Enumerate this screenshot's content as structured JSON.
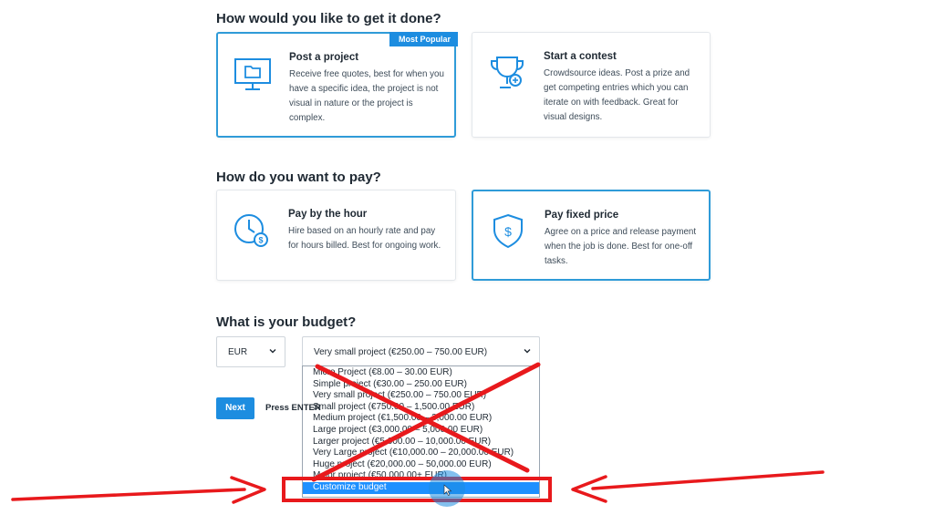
{
  "section1": {
    "heading": "How would you like to get it done?",
    "cards": [
      {
        "title": "Post a project",
        "desc": "Receive free quotes, best for when you have a specific idea, the project is not visual in nature or the project is complex.",
        "badge": "Most Popular",
        "icon": "monitor-folder-icon",
        "selected": true
      },
      {
        "title": "Start a contest",
        "desc": "Crowdsource ideas. Post a prize and get competing entries which you can iterate on with feedback. Great for visual designs.",
        "icon": "trophy-icon",
        "selected": false
      }
    ]
  },
  "section2": {
    "heading": "How do you want to pay?",
    "cards": [
      {
        "title": "Pay by the hour",
        "desc": "Hire based on an hourly rate and pay for hours billed. Best for ongoing work.",
        "icon": "clock-dollar-icon",
        "selected": false
      },
      {
        "title": "Pay fixed price",
        "desc": "Agree on a price and release payment when the job is done. Best for one-off tasks.",
        "icon": "shield-dollar-icon",
        "selected": true
      }
    ]
  },
  "budget": {
    "heading": "What is your budget?",
    "currency": "EUR",
    "selected": "Very small project (€250.00 – 750.00 EUR)",
    "options": [
      "Micro Project (€8.00 – 30.00 EUR)",
      "Simple project (€30.00 – 250.00 EUR)",
      "Very small project (€250.00 – 750.00 EUR)",
      "Small project (€750.00 – 1,500.00 EUR)",
      "Medium project (€1,500.00 – 3,000.00 EUR)",
      "Large project (€3,000.00 – 5,000.00 EUR)",
      "Larger project (€5,000.00 – 10,000.00 EUR)",
      "Very Large project (€10,000.00 – 20,000.00 EUR)",
      "Huge project (€20,000.00 – 50,000.00 EUR)",
      "Major project (€50,000.00+ EUR)",
      "Customize budget"
    ],
    "highlighted_index": 10
  },
  "actions": {
    "next_label": "Next",
    "press_text": "Press ENTER"
  },
  "colors": {
    "accent": "#1d8de0",
    "annotation": "#e8191c",
    "highlight": "#1e90ff"
  }
}
